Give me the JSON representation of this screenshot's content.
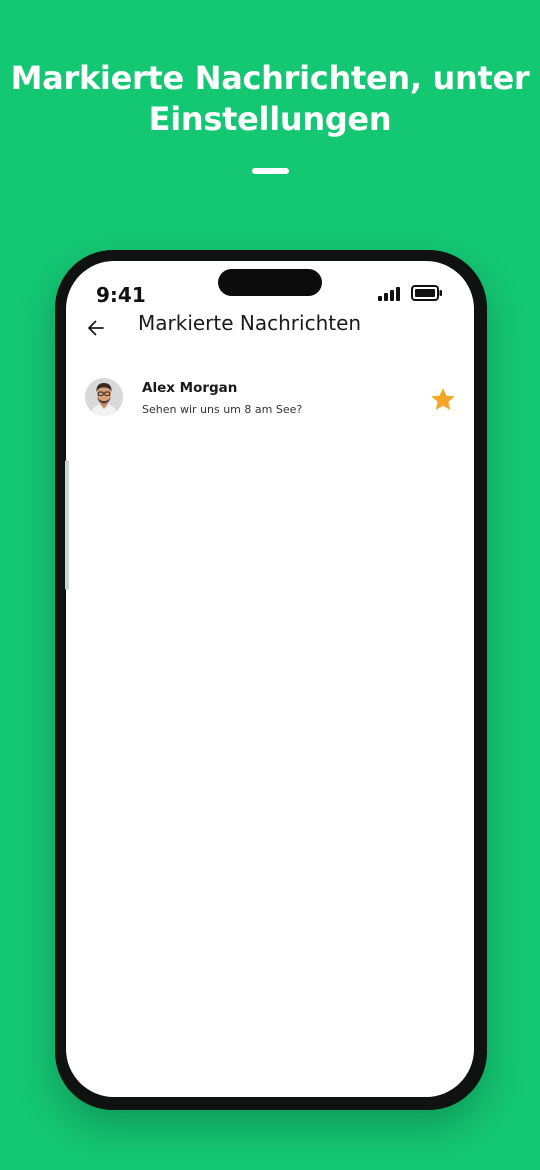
{
  "promo": {
    "title": "Markierte Nachrichten, unter Einstellungen"
  },
  "status_bar": {
    "time": "9:41",
    "signal_icon": "cellular-signal-icon",
    "battery_icon": "battery-icon"
  },
  "header": {
    "back_icon": "arrow-left-icon",
    "title": "Markierte Nachrichten"
  },
  "starred_messages": [
    {
      "sender": "Alex Morgan",
      "text": "Sehen wir uns um 8 am See?",
      "starred": true,
      "star_color": "#f5a623"
    }
  ],
  "colors": {
    "background": "#14c773",
    "phone_frame": "#0f1211",
    "star": "#f5a623"
  }
}
